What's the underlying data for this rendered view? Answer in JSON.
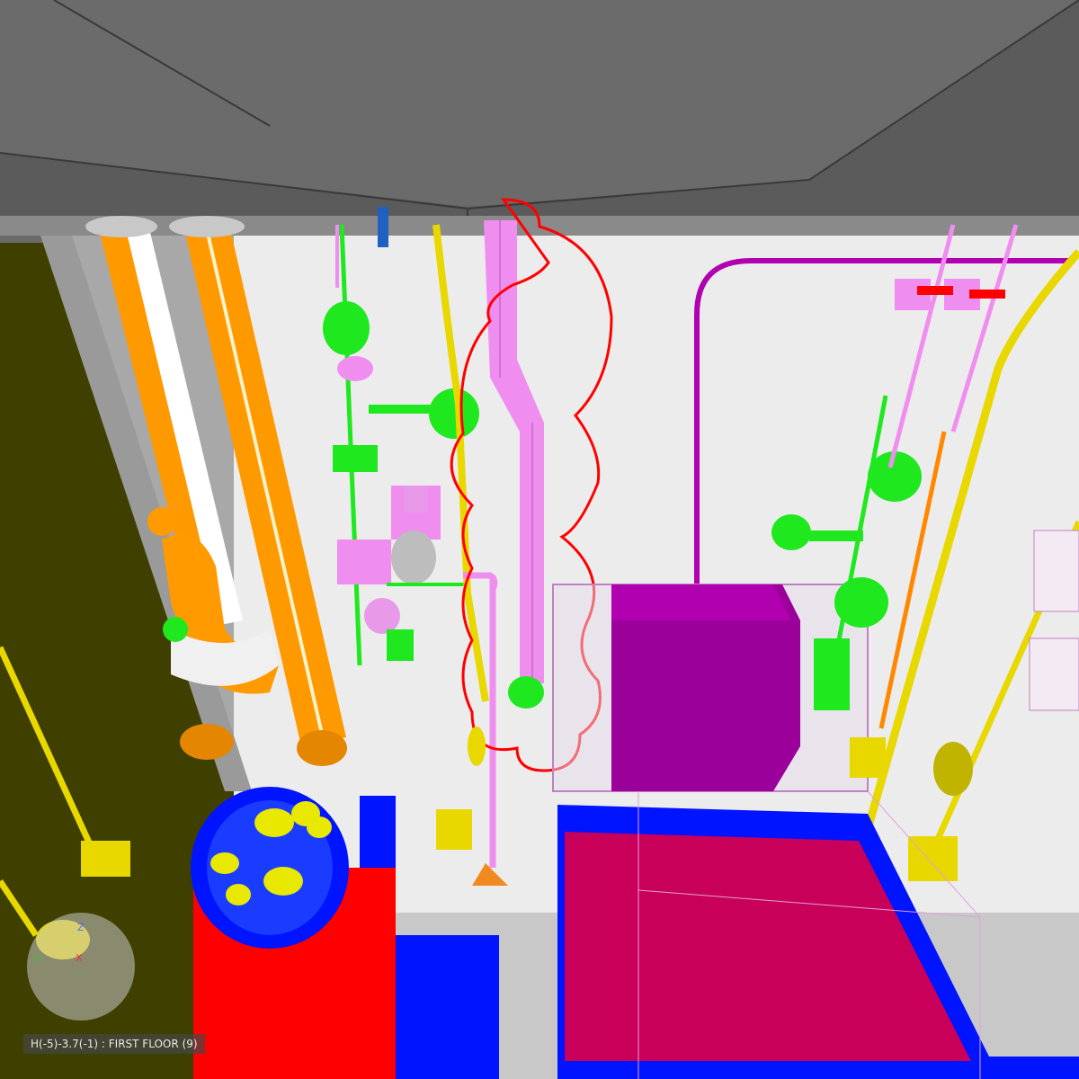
{
  "status_bar": {
    "location": "H(-5)-3.7(-1) : FIRST FLOOR (9)"
  },
  "navigation": {
    "axes": {
      "z": "Z",
      "x": "X",
      "y": "Y"
    }
  },
  "scene": {
    "description_colors": {
      "ceiling": "#5a5a5a",
      "wall": "#ececec",
      "side_wall": "#3a3a00",
      "orange_pipe": "#ff9a00",
      "pink_pipe": "#f08ef0",
      "yellow_pipe": "#f0e000",
      "green_valve": "#1fe81f",
      "purple_cabinet": "#9b009b",
      "blue_frame": "#0014ff",
      "red_tank": "#ff0000",
      "crimson_floor": "#c8005a",
      "markup_cloud": "#ff0000"
    }
  }
}
